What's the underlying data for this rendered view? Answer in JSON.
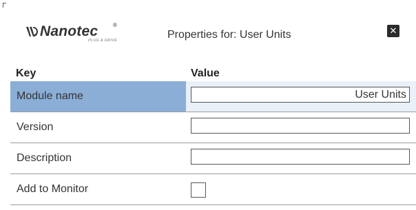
{
  "header": {
    "logo": {
      "word": "Nanotec",
      "registered": "®",
      "tagline": "PLUG & DRIVE"
    },
    "title": "Properties for: User Units",
    "close_icon": "close-icon"
  },
  "table": {
    "headers": {
      "key": "Key",
      "value": "Value"
    },
    "rows": [
      {
        "key": "Module name",
        "value": "User Units",
        "type": "text",
        "selected": true
      },
      {
        "key": "Version",
        "value": "",
        "type": "text",
        "selected": false
      },
      {
        "key": "Description",
        "value": "",
        "type": "text",
        "selected": false
      },
      {
        "key": "Add to Monitor",
        "checked": false,
        "type": "checkbox",
        "selected": false
      }
    ]
  },
  "colors": {
    "selected_key_bg": "#8aaed6",
    "selected_value_bg": "#e9f0f8",
    "close_button_bg": "#2b2b2b"
  }
}
